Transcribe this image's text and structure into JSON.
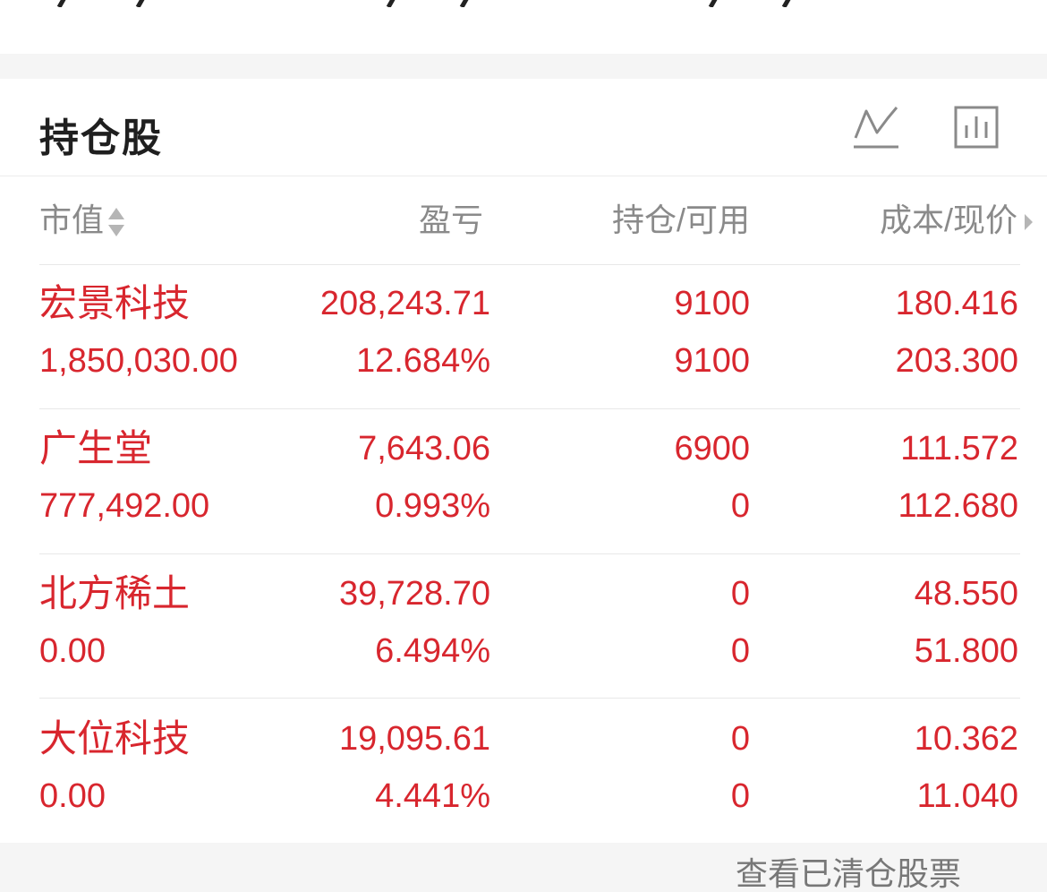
{
  "section": {
    "title": "持仓股",
    "icons": [
      "line-chart-icon",
      "bar-chart-icon"
    ]
  },
  "table": {
    "headers": {
      "market_value": "市值",
      "profit_loss": "盈亏",
      "position_available": "持仓/可用",
      "cost_price": "成本/现价"
    },
    "rows": [
      {
        "name": "宏景科技",
        "market_value": "1,850,030.00",
        "pl_amount": "208,243.71",
        "pl_percent": "12.684%",
        "position": "9100",
        "available": "9100",
        "cost": "180.416",
        "price": "203.300"
      },
      {
        "name": "广生堂",
        "market_value": "777,492.00",
        "pl_amount": "7,643.06",
        "pl_percent": "0.993%",
        "position": "6900",
        "available": "0",
        "cost": "111.572",
        "price": "112.680"
      },
      {
        "name": "北方稀土",
        "market_value": "0.00",
        "pl_amount": "39,728.70",
        "pl_percent": "6.494%",
        "position": "0",
        "available": "0",
        "cost": "48.550",
        "price": "51.800"
      },
      {
        "name": "大位科技",
        "market_value": "0.00",
        "pl_amount": "19,095.61",
        "pl_percent": "4.441%",
        "position": "0",
        "available": "0",
        "cost": "10.362",
        "price": "11.040"
      }
    ]
  },
  "footer": {
    "link_partial": "查看已清仓股票"
  },
  "colors": {
    "gain_red": "#d8262e",
    "header_gray": "#8a8a8a",
    "title_dark": "#1f1f1f",
    "page_bg": "#f5f5f5"
  }
}
